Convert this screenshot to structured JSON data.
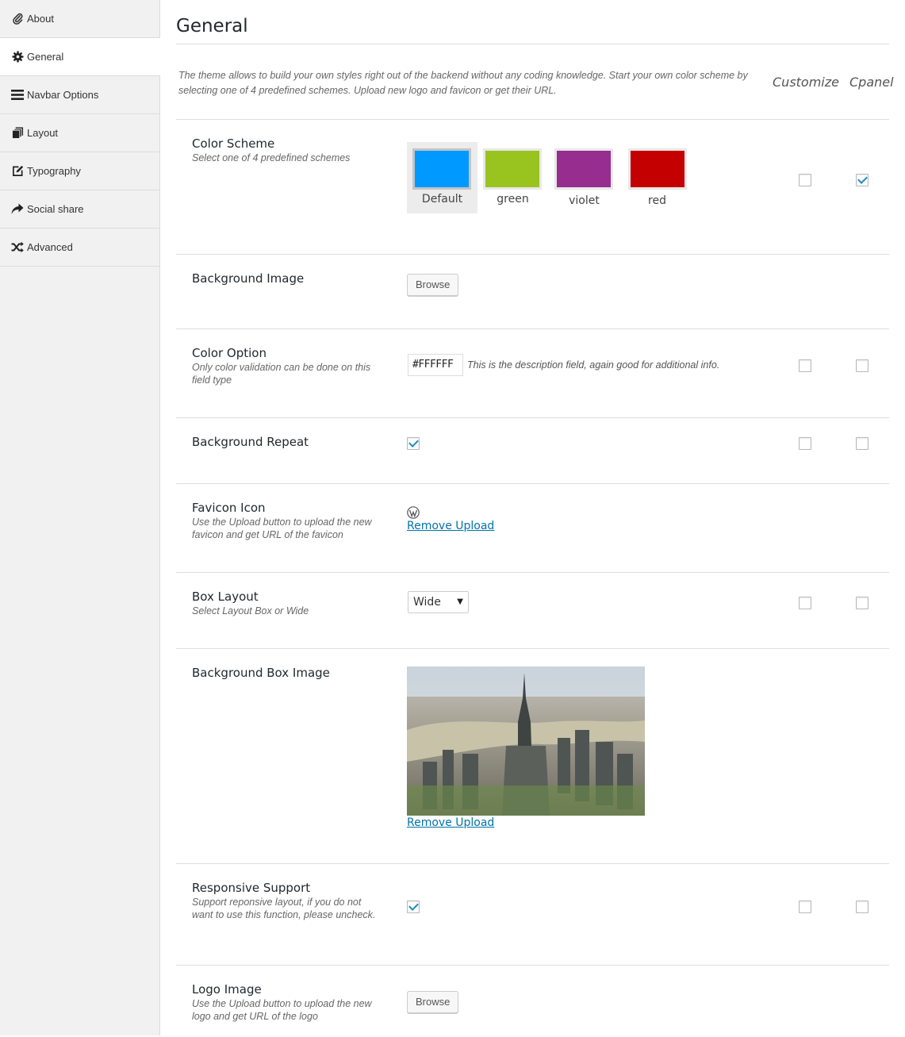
{
  "sidebar": {
    "items": [
      {
        "label": "About",
        "icon": "paperclip-icon"
      },
      {
        "label": "General",
        "icon": "gear-icon"
      },
      {
        "label": "Navbar Options",
        "icon": "bars-icon"
      },
      {
        "label": "Layout",
        "icon": "files-icon"
      },
      {
        "label": "Typography",
        "icon": "edit-icon"
      },
      {
        "label": "Social share",
        "icon": "share-icon"
      },
      {
        "label": "Advanced",
        "icon": "shuffle-icon"
      }
    ],
    "active": "General"
  },
  "header": {
    "title": "General"
  },
  "intro": {
    "text": "The theme allows to build your own styles right out of the backend without any coding knowledge. Start your own color scheme by selecting one of 4 predefined schemes. Upload new logo and favicon or get their URL.",
    "col_customize": "Customize",
    "col_cpanel": "Cpanel"
  },
  "color_scheme": {
    "label": "Color Scheme",
    "desc": "Select one of 4 predefined schemes",
    "options": [
      {
        "label": "Default",
        "color": "#0099ff",
        "selected": true
      },
      {
        "label": "green",
        "color": "#99c31e",
        "selected": false
      },
      {
        "label": "violet",
        "color": "#962d8f",
        "selected": false
      },
      {
        "label": "red",
        "color": "#c40000",
        "selected": false
      }
    ],
    "customize": false,
    "cpanel": true
  },
  "background_image": {
    "label": "Background Image",
    "button": "Browse"
  },
  "color_option": {
    "label": "Color Option",
    "desc": "Only color validation can be done on this field type",
    "value": "#FFFFFF",
    "field_desc": "This is the description field, again good for additional info.",
    "customize": false,
    "cpanel": false
  },
  "background_repeat": {
    "label": "Background Repeat",
    "checked": true,
    "customize": false,
    "cpanel": false
  },
  "favicon": {
    "label": "Favicon Icon",
    "desc": "Use the Upload button to upload the new favicon and get URL of the favicon",
    "icon": "wordpress-icon",
    "link": "Remove Upload"
  },
  "box_layout": {
    "label": "Box Layout",
    "desc": "Select Layout Box or Wide",
    "selected": "Wide",
    "customize": false,
    "cpanel": false
  },
  "background_box_image": {
    "label": "Background Box Image",
    "link": "Remove Upload"
  },
  "responsive": {
    "label": "Responsive Support",
    "desc": "Support reponsive layout, if you do not want to use this function, please uncheck.",
    "checked": true,
    "customize": false,
    "cpanel": false
  },
  "logo_image": {
    "label": "Logo Image",
    "desc": "Use the Upload button to upload the new logo and get URL of the logo",
    "button": "Browse"
  }
}
